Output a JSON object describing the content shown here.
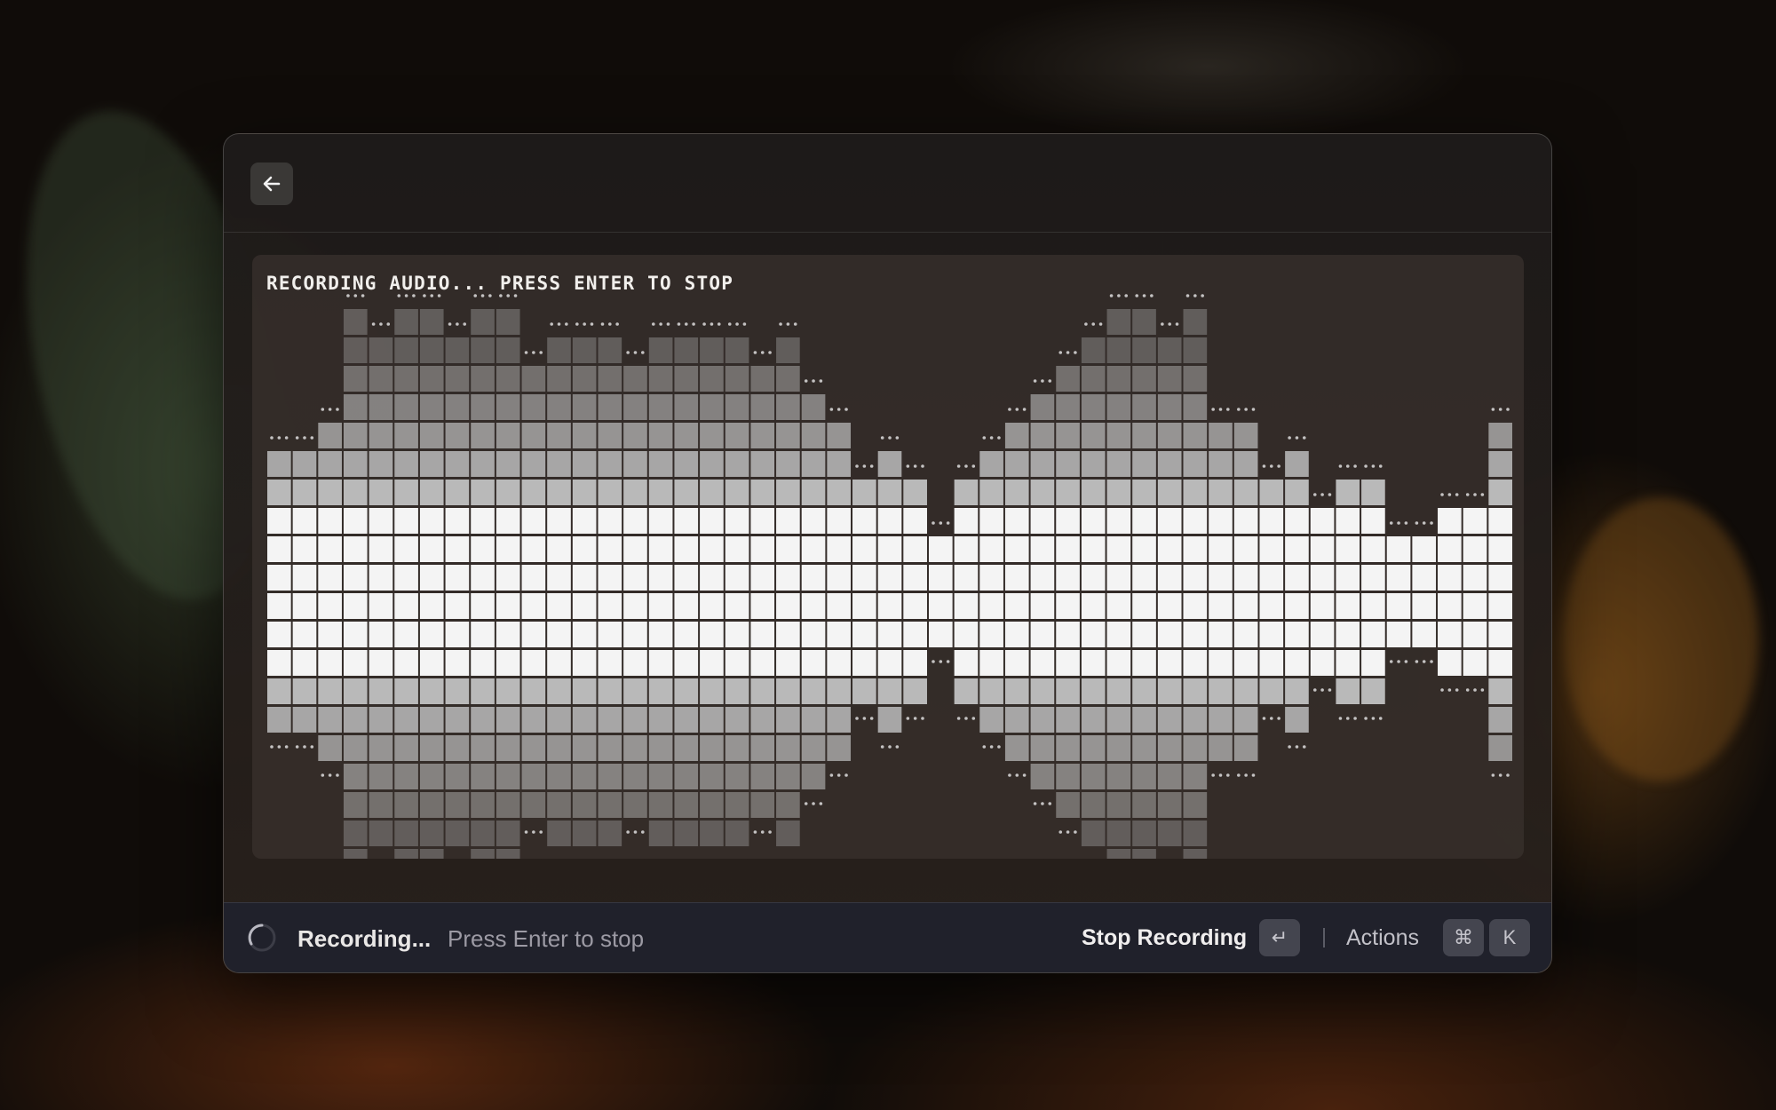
{
  "window": {
    "back_icon": "arrow-left-icon"
  },
  "recording": {
    "heading": "RECORDING AUDIO... PRESS ENTER TO STOP",
    "waveform_levels": [
      5,
      5,
      6,
      10,
      9,
      10,
      10,
      9,
      10,
      10,
      8,
      9,
      9,
      9,
      8,
      9,
      9,
      9,
      9,
      8,
      9,
      7,
      6,
      4,
      5,
      4,
      2,
      4,
      5,
      6,
      7,
      8,
      9,
      10,
      10,
      9,
      10,
      6,
      6,
      4,
      5,
      3,
      4,
      4,
      2,
      2,
      3,
      3,
      6
    ]
  },
  "footer": {
    "spinner_icon": "loading-spinner-icon",
    "status": "Recording...",
    "hint": "Press Enter to stop",
    "primary_action": "Stop Recording",
    "enter_key": "↵",
    "actions_label": "Actions",
    "cmd_key": "⌘",
    "k_key": "K"
  },
  "colors": {
    "wave_bright": "#f4f4f4",
    "wave_dim": "#b9b9b9",
    "panel": "#3a322e"
  }
}
